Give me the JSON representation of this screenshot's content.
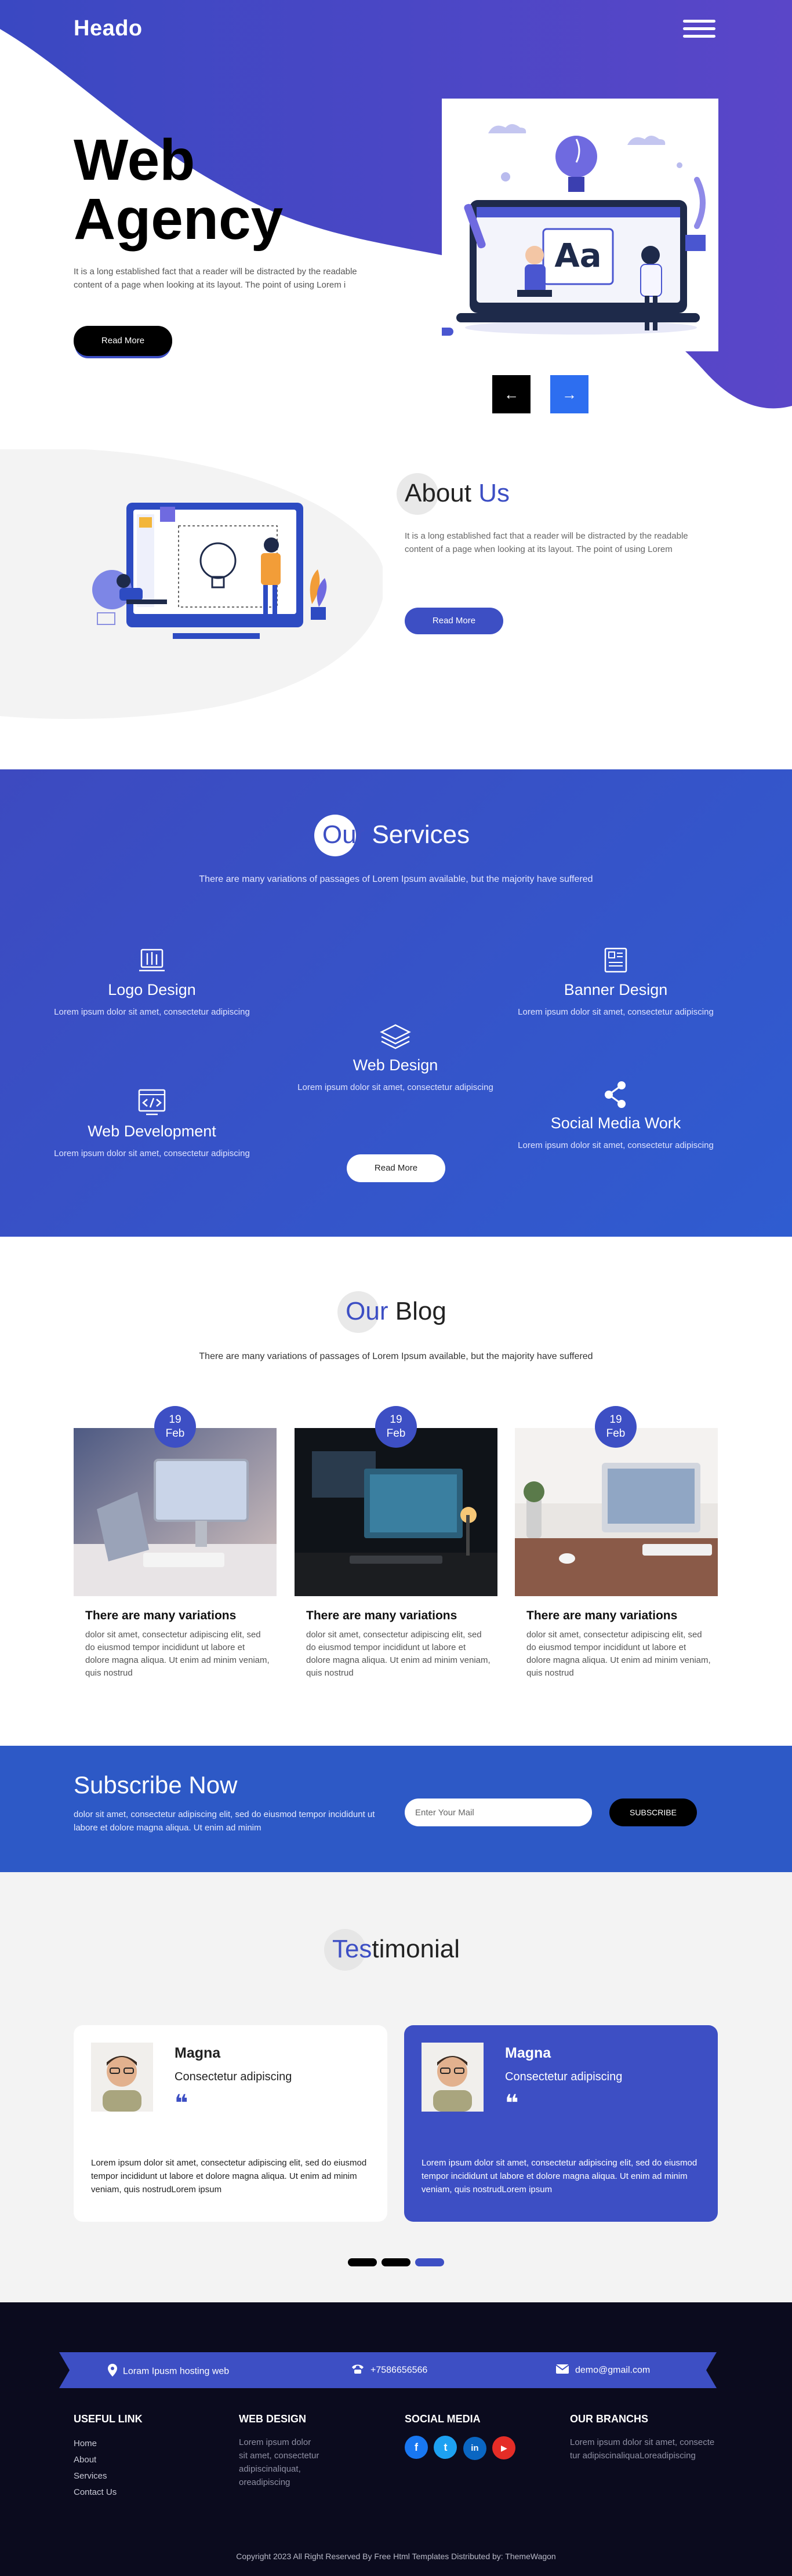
{
  "header": {
    "logo": "Heado",
    "menu_icon": "hamburger-icon"
  },
  "hero": {
    "title_line1": "Web",
    "title_line2": "Agency",
    "text": "It is a long established fact that a reader will be distracted by the readable content of a page when looking at its layout. The point of using Lorem i",
    "button": "Read More",
    "prev_arrow": "←",
    "next_arrow": "→",
    "colors": {
      "accent": "#3d4fc4",
      "arrow_active": "#2d6ef0"
    }
  },
  "about": {
    "title_hl": "About",
    "title_rest": "Us",
    "text": "It is a long established fact that a reader will be distracted by the readable content of a page when looking at its layout. The point of using Lorem",
    "button": "Read More"
  },
  "services": {
    "title_hl": "Our",
    "title_rest": "Services",
    "subtitle": "There are many variations of passages of Lorem Ipsum available, but the majority have suffered",
    "items": [
      {
        "title": "Logo Design",
        "text": "Lorem ipsum dolor sit amet, consectetur adipiscing",
        "icon": "logo-design-icon"
      },
      {
        "title": "Web Design",
        "text": "Lorem ipsum dolor sit amet, consectetur adipiscing",
        "icon": "layers-icon"
      },
      {
        "title": "Banner Design",
        "text": "Lorem ipsum dolor sit amet, consectetur adipiscing",
        "icon": "banner-icon"
      },
      {
        "title": "Web Development",
        "text": "Lorem ipsum dolor sit amet, consectetur adipiscing",
        "icon": "code-icon"
      },
      {
        "title": "Social Media Work",
        "text": "Lorem ipsum dolor sit amet, consectetur adipiscing",
        "icon": "share-icon"
      }
    ],
    "button": "Read More"
  },
  "blog": {
    "title_hl": "Our",
    "title_rest": "Blog",
    "subtitle": "There are many variations of passages of Lorem Ipsum available, but the majority have suffered",
    "posts": [
      {
        "day": "19",
        "month": "Feb",
        "title": "There are many variations",
        "text": "dolor sit amet, consectetur adipiscing elit, sed do eiusmod tempor incididunt ut labore et dolore magna aliqua. Ut enim ad minim veniam, quis nostrud"
      },
      {
        "day": "19",
        "month": "Feb",
        "title": "There are many variations",
        "text": "dolor sit amet, consectetur adipiscing elit, sed do eiusmod tempor incididunt ut labore et dolore magna aliqua. Ut enim ad minim veniam, quis nostrud"
      },
      {
        "day": "19",
        "month": "Feb",
        "title": "There are many variations",
        "text": "dolor sit amet, consectetur adipiscing elit, sed do eiusmod tempor incididunt ut labore et dolore magna aliqua. Ut enim ad minim veniam, quis nostrud"
      }
    ]
  },
  "subscribe": {
    "title": "Subscribe Now",
    "text": "dolor sit amet, consectetur adipiscing elit, sed do eiusmod tempor incididunt ut labore et dolore magna aliqua. Ut enim ad minim",
    "placeholder": "Enter Your Mail",
    "button": "SUBSCRIBE"
  },
  "testimonial": {
    "title_hl": "Tes",
    "title_rest": "timonial",
    "cards": [
      {
        "name": "Magna",
        "role": "Consectetur adipiscing",
        "quote": "❝",
        "text": "Lorem ipsum dolor sit amet, consectetur adipiscing elit, sed do eiusmod tempor incididunt ut labore et dolore magna aliqua. Ut enim ad minim veniam, quis nostrudLorem ipsum"
      },
      {
        "name": "Magna",
        "role": "Consectetur adipiscing",
        "quote": "❝",
        "text": "Lorem ipsum dolor sit amet, consectetur adipiscing elit, sed do eiusmod tempor incididunt ut labore et dolore magna aliqua. Ut enim ad minim veniam, quis nostrudLorem ipsum"
      }
    ],
    "active_slide": 3
  },
  "footer": {
    "contacts": {
      "location": "Loram Ipusm hosting web",
      "phone": "+7586656566",
      "email": "demo@gmail.com"
    },
    "columns": {
      "useful_title": "USEFUL LINK",
      "useful_links": [
        "Home",
        "About",
        "Services",
        "Contact Us"
      ],
      "webdesign_title": "WEB DESIGN",
      "webdesign_text": "Lorem ipsum dolor sit amet, consectetur adipiscinaliquat, oreadipiscing",
      "social_title": "SOCIAL MEDIA",
      "social": [
        {
          "label": "f",
          "color": "#1877f2"
        },
        {
          "label": "t",
          "color": "#1da1f2"
        },
        {
          "label": "in",
          "color": "#0a66c2"
        },
        {
          "label": "▶",
          "color": "#e52d27"
        }
      ],
      "branches_title": "OUR BRANCHS",
      "branches_text": "Lorem ipsum dolor sit amet, consectetur adipiscinaliquaLoreadipiscing"
    },
    "copyright": "Copyright 2023 All Right Reserved By Free Html Templates Distributed by: ThemeWagon"
  }
}
